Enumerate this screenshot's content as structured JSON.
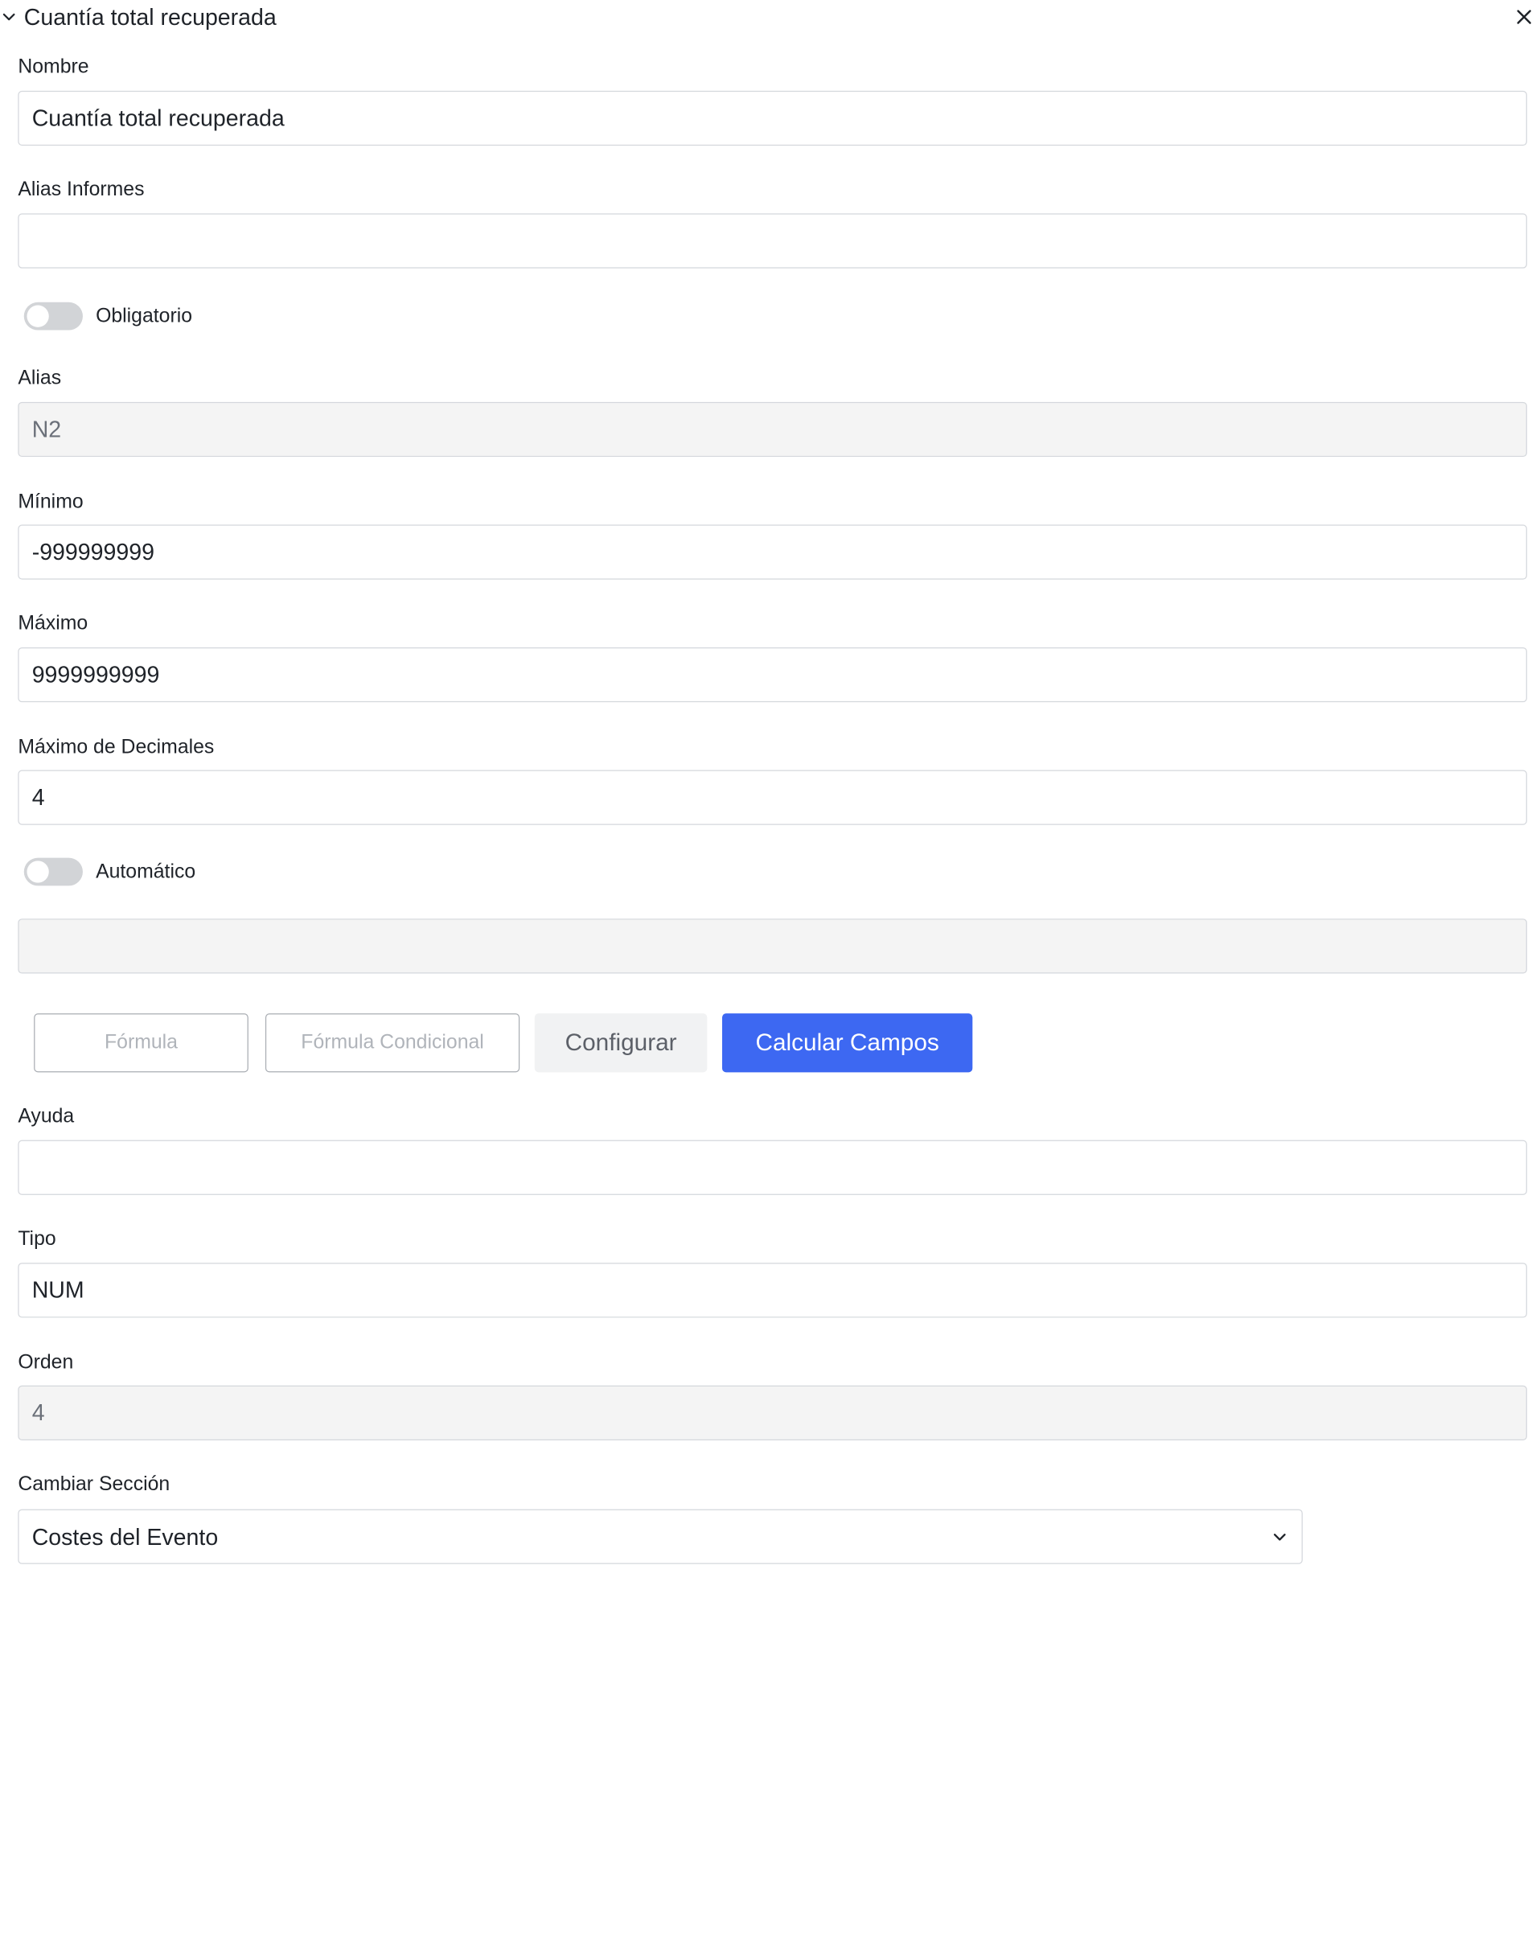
{
  "header": {
    "title": "Cuantía total recuperada"
  },
  "fields": {
    "nombre": {
      "label": "Nombre",
      "value": "Cuantía total recuperada"
    },
    "alias_informes": {
      "label": "Alias Informes",
      "value": ""
    },
    "obligatorio": {
      "label": "Obligatorio",
      "on": false
    },
    "alias": {
      "label": "Alias",
      "value": "N2"
    },
    "minimo": {
      "label": "Mínimo",
      "value": "-999999999"
    },
    "maximo": {
      "label": "Máximo",
      "value": "9999999999"
    },
    "max_decimales": {
      "label": "Máximo de Decimales",
      "value": "4"
    },
    "automatico": {
      "label": "Automático",
      "on": false
    },
    "formula_text": {
      "value": ""
    },
    "ayuda": {
      "label": "Ayuda",
      "value": ""
    },
    "tipo": {
      "label": "Tipo",
      "value": "NUM"
    },
    "orden": {
      "label": "Orden",
      "value": "4"
    },
    "cambiar_seccion": {
      "label": "Cambiar Sección",
      "value": "Costes del Evento"
    }
  },
  "buttons": {
    "formula": "Fórmula",
    "formula_condicional": "Fórmula Condicional",
    "configurar": "Configurar",
    "calcular_campos": "Calcular Campos"
  },
  "icons": {
    "collapse": "chevron-down-icon",
    "close": "close-icon",
    "select_caret": "chevron-down-icon"
  },
  "colors": {
    "primary": "#3d68f2",
    "disabled_bg": "#f4f4f4",
    "toggle_off": "#d2d4d7"
  }
}
